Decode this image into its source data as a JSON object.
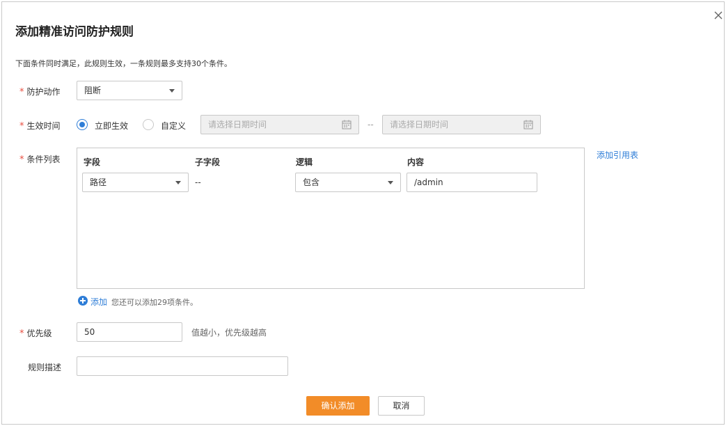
{
  "dialog": {
    "title": "添加精准访问防护规则",
    "hint": "下面条件同时满足，此规则生效，一条规则最多支持30个条件。"
  },
  "protective_action": {
    "label": "防护动作",
    "value": "阻断"
  },
  "effective_time": {
    "label": "生效时间",
    "option_immediate": "立即生效",
    "option_custom": "自定义",
    "selected": "立即生效",
    "start_placeholder": "请选择日期时间",
    "separator": "--",
    "end_placeholder": "请选择日期时间"
  },
  "conditions": {
    "label": "条件列表",
    "add_reference_table": "添加引用表",
    "headers": {
      "field": "字段",
      "subfield": "子字段",
      "logic": "逻辑",
      "content": "内容"
    },
    "rows": [
      {
        "field": "路径",
        "subfield": "--",
        "logic": "包含",
        "content": "/admin"
      }
    ],
    "add_label": "添加",
    "add_hint": "您还可以添加29项条件。"
  },
  "priority": {
    "label": "优先级",
    "value": "50",
    "hint": "值越小，优先级越高"
  },
  "description": {
    "label": "规则描述",
    "value": ""
  },
  "buttons": {
    "confirm": "确认添加",
    "cancel": "取消"
  },
  "colors": {
    "accent_blue": "#2e7dd7",
    "primary_orange": "#f28c28",
    "required_red": "#e84e40"
  }
}
